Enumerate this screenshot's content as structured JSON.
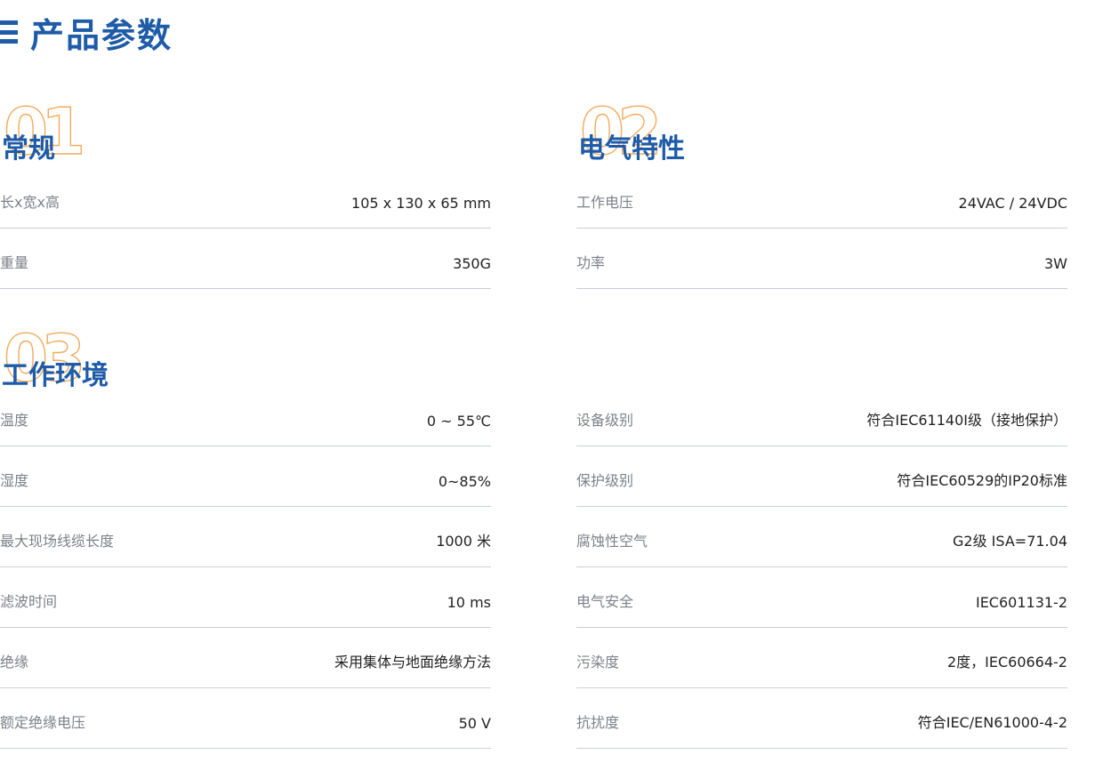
{
  "page": {
    "title": "产品参数",
    "accent_color": "#1e5ba8",
    "number_color": "#f0a24c"
  },
  "sections": {
    "general": {
      "number": "01",
      "title": "常规",
      "rows": [
        {
          "label": "长x宽x高",
          "value": "105 x 130 x 65 mm"
        },
        {
          "label": "重量",
          "value": "350G"
        }
      ]
    },
    "electrical": {
      "number": "02",
      "title": "电气特性",
      "rows": [
        {
          "label": "工作电压",
          "value": "24VAC / 24VDC"
        },
        {
          "label": "功率",
          "value": "3W"
        }
      ]
    },
    "environment": {
      "number": "03",
      "title": "工作环境",
      "left_rows": [
        {
          "label": "温度",
          "value": "0 ~ 55℃"
        },
        {
          "label": "湿度",
          "value": "0~85%"
        },
        {
          "label": "最大现场线缆长度",
          "value": "1000 米"
        },
        {
          "label": "滤波时间",
          "value": "10 ms"
        },
        {
          "label": "绝缘",
          "value": "采用集体与地面绝缘方法"
        },
        {
          "label": "额定绝缘电压",
          "value": "50 V"
        }
      ],
      "right_rows": [
        {
          "label": "设备级别",
          "value": "符合IEC61140I级（接地保护）"
        },
        {
          "label": "保护级别",
          "value": "符合IEC60529的IP20标准"
        },
        {
          "label": "腐蚀性空气",
          "value": "G2级 ISA=71.04"
        },
        {
          "label": "电气安全",
          "value": "IEC601131-2"
        },
        {
          "label": "污染度",
          "value": "2度，IEC60664-2"
        },
        {
          "label": "抗扰度",
          "value": "符合IEC/EN61000-4-2"
        }
      ]
    }
  }
}
